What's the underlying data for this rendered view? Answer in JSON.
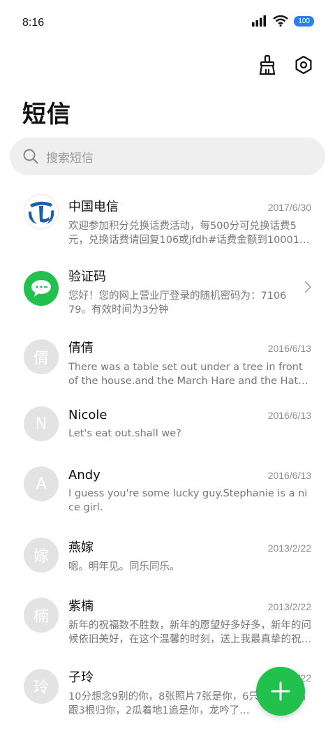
{
  "status": {
    "time": "8:16",
    "battery": "100"
  },
  "header": {
    "title": "短信"
  },
  "search": {
    "placeholder": "搜索短信"
  },
  "messages": [
    {
      "name": "中国电信",
      "date": "2017/6/30",
      "snippet": "欢迎参加积分兑换话费活动，每500分可兑换话费5元，兑换话费请回复106或jfdh#话费金额到10001。回复…",
      "avatar": "telecom-logo"
    },
    {
      "name": "验证码",
      "date": "",
      "snippet": "您好！您的网上营业厅登录的随机密码为：710679。有效时间为3分钟",
      "avatar": "chat-icon"
    },
    {
      "name": "倩倩",
      "date": "2016/6/13",
      "snippet": "There was a table set out under a tree in front of the house.and the March Hare and the Hatt…",
      "avatar_text": "倩"
    },
    {
      "name": "Nicole",
      "date": "2016/6/13",
      "snippet": "Let's eat out.shall we?",
      "avatar_text": "N"
    },
    {
      "name": "Andy",
      "date": "2016/6/13",
      "snippet": "I guess you're some lucky guy.Stephanie is a nice girl.",
      "avatar_text": "A"
    },
    {
      "name": "燕嫁",
      "date": "2013/2/22",
      "snippet": "嗯。明年见。同乐同乐。",
      "avatar_text": "嫁"
    },
    {
      "name": "紫楠",
      "date": "2013/2/22",
      "snippet": "新年的祝福数不胜数，新年的愿望好多好多，新年的问候依旧美好，在这个温馨的时刻，送上我最真挚的祝福，…",
      "avatar_text": "楠"
    },
    {
      "name": "子玲",
      "date": "2013/2/22",
      "snippet": "10分想念9别的你，8张照片7张是你，6只小…4根高跟3根归你，2瓜着地1追是你，龙吟了…",
      "avatar_text": "玲"
    }
  ],
  "colors": {
    "accent": "#22c04d",
    "battery": "#2e7cf6"
  }
}
